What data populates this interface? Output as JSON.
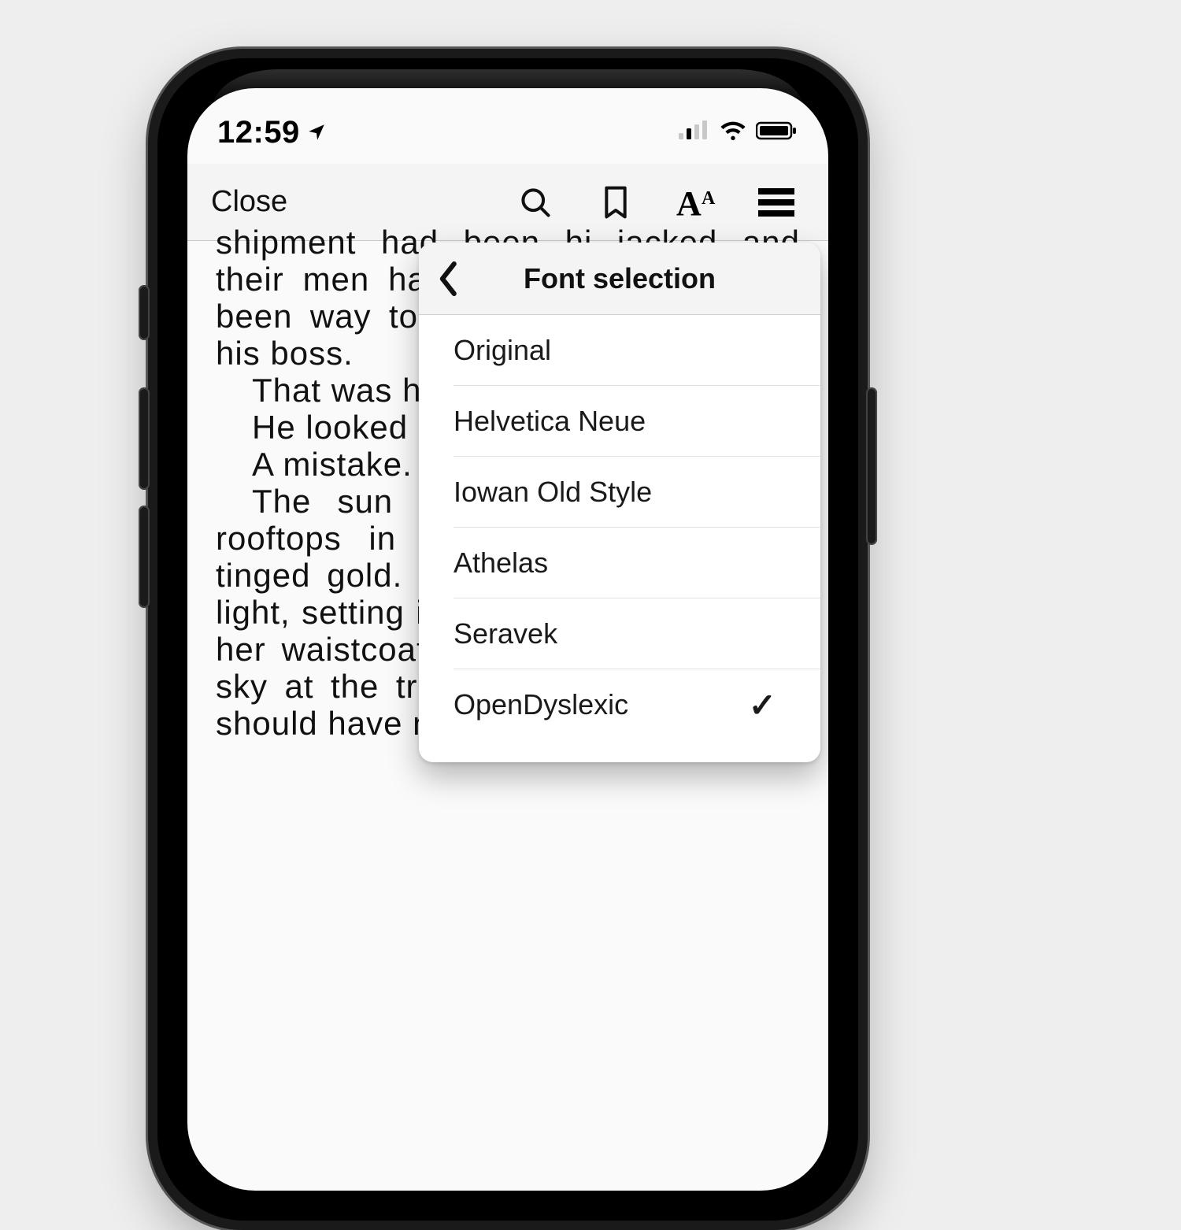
{
  "statusbar": {
    "time": "12:59"
  },
  "toolbar": {
    "close_label": "Close"
  },
  "book_text": {
    "p1": "shipment had been hi jacked and their men had been killed and he'd been way too busy tak- ing care of his boss.",
    "p2": "That was his only job.",
    "p3": "He looked away.",
    "p4": "A mistake.",
    "p5": "The sun  sank  over  the Mayfair rooftops in a cascade of copper-tinged  gold.  Gar- dens,  catching  the  light, setting  it  aglow.  And  the satin of her  waistcoat—blue, the color of  the  sky  at  the trick  of  the  light—no  one should  have  noticed  that  it  was"
  },
  "popover": {
    "title": "Font selection",
    "items": [
      {
        "label": "Original",
        "selected": false
      },
      {
        "label": "Helvetica Neue",
        "selected": false
      },
      {
        "label": "Iowan Old Style",
        "selected": false
      },
      {
        "label": "Athelas",
        "selected": false
      },
      {
        "label": "Seravek",
        "selected": false
      },
      {
        "label": "OpenDyslexic",
        "selected": true
      }
    ]
  }
}
